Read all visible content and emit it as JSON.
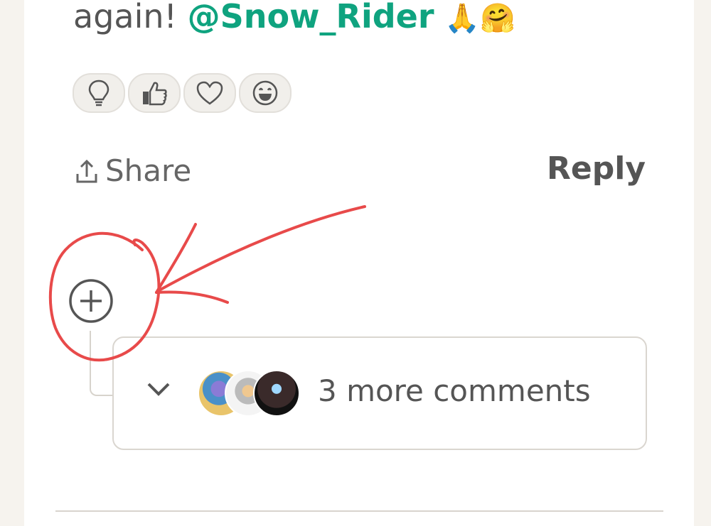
{
  "comment": {
    "text_prefix": "again!",
    "mention": "@Snow_Rider",
    "emoji_1": "🙏",
    "emoji_2": "🤗"
  },
  "reactions": [
    {
      "icon": "lightbulb-icon"
    },
    {
      "icon": "thumbs-up-icon"
    },
    {
      "icon": "heart-icon"
    },
    {
      "icon": "laughing-face-icon"
    }
  ],
  "actions": {
    "share_label": "Share",
    "reply_label": "Reply"
  },
  "thread": {
    "expand_icon": "plus-circle-icon",
    "more_comments_label": "3 more comments",
    "chevron_icon": "chevron-down-icon"
  },
  "colors": {
    "mention": "#0fa37f",
    "annotation": "#e84a4a"
  }
}
